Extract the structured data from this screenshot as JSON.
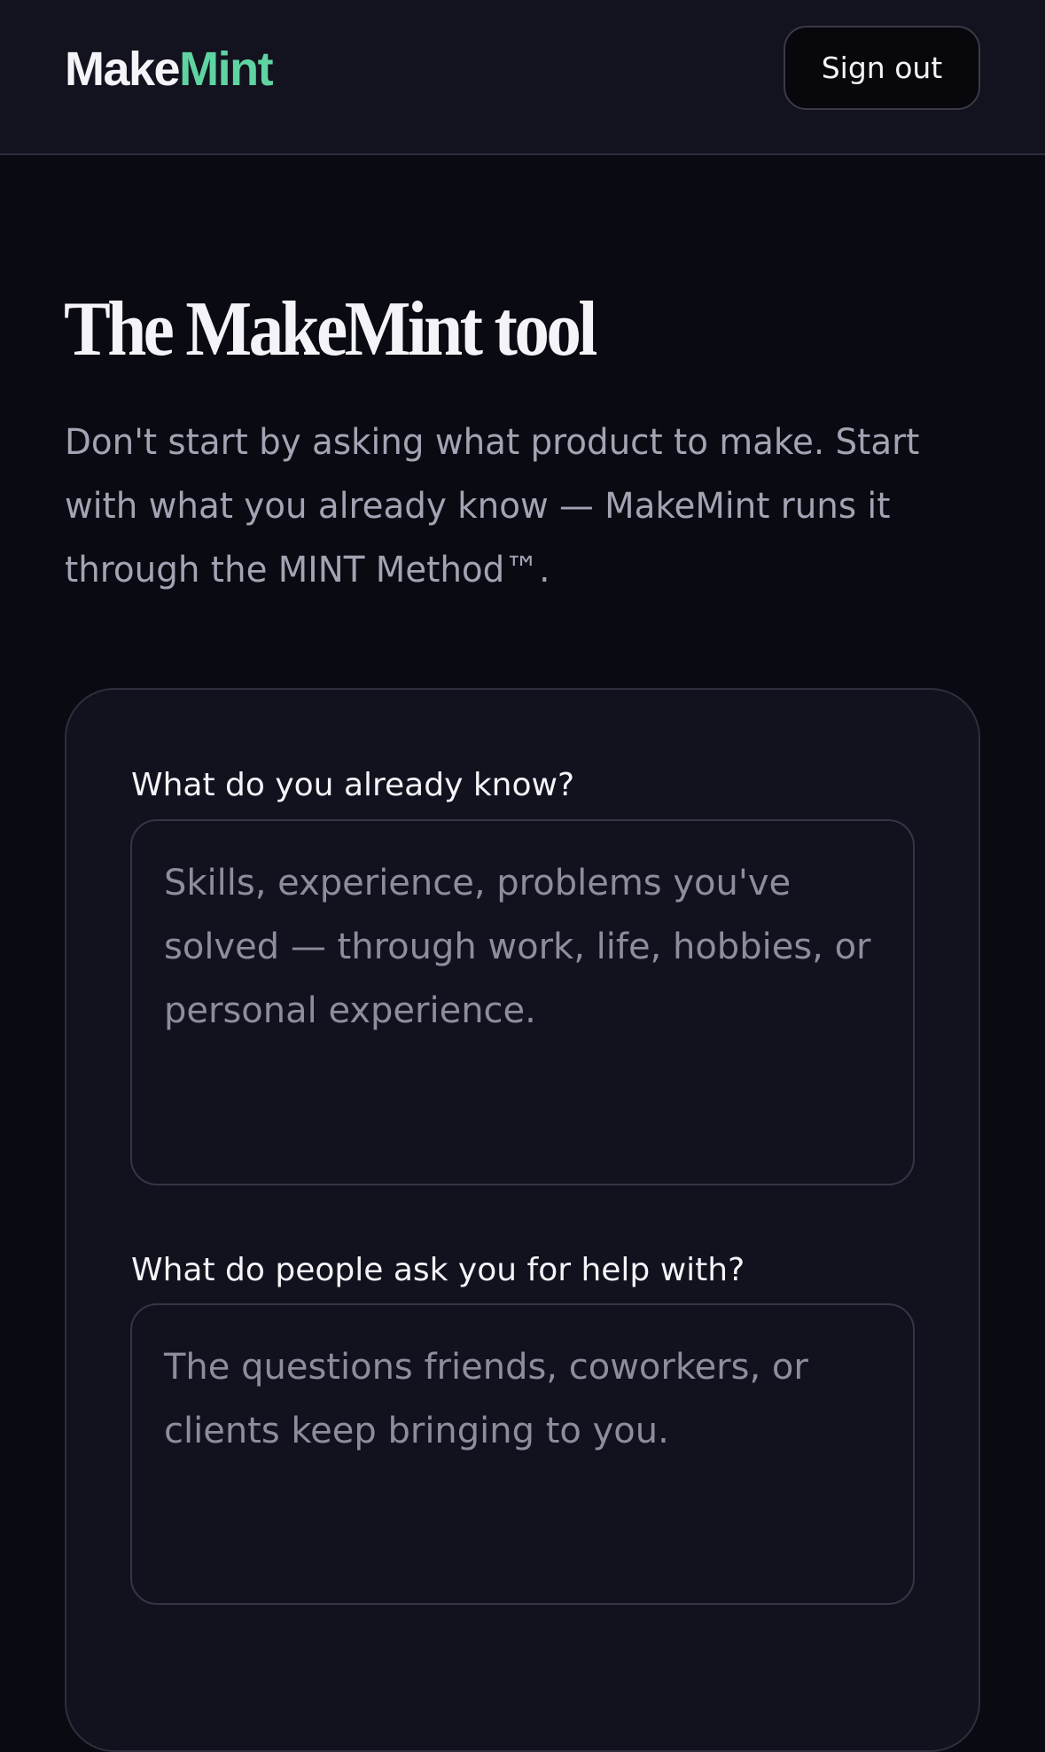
{
  "header": {
    "logo_part1": "Make",
    "logo_part2": "Mint",
    "signout_label": "Sign out"
  },
  "page": {
    "title": "The MakeMint tool",
    "subtitle": "Don't start by asking what product to make. Start with what you already know — MakeMint runs it through the MINT Method™."
  },
  "form": {
    "q1": {
      "label": "What do you already know?",
      "placeholder": "Skills, experience, problems you've solved — through work, life, hobbies, or personal experience.",
      "value": ""
    },
    "q2": {
      "label": "What do people ask you for help with?",
      "placeholder": "The questions friends, coworkers, or clients keep bringing to you.",
      "value": ""
    }
  },
  "colors": {
    "background": "#0a0a12",
    "header_bg": "#13131f",
    "card_bg": "#12121f",
    "accent_mint": "#5fd4a2",
    "muted_text": "#a3a3b3"
  }
}
